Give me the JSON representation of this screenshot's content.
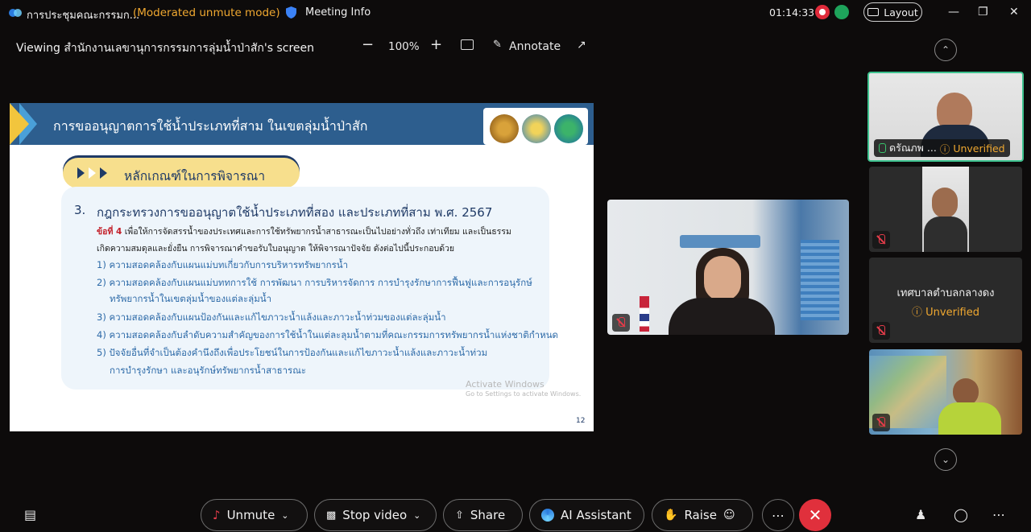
{
  "titlebar": {
    "app_title": "การประชุมคณะกรรมก...",
    "mode": "(Moderated unmute mode)",
    "meeting_info": "Meeting Info",
    "clock": "01:14:33",
    "layout": "Layout"
  },
  "sharebar": {
    "viewing": "Viewing สำนักงานเลขานุการกรรมการลุ่มน้ำป่าสัก's screen",
    "zoom": "100%",
    "annotate": "Annotate"
  },
  "slide": {
    "title": "การขออนุญาตการใช้น้ำประเภทที่สาม ในเขตลุ่มน้ำป่าสัก",
    "heading": "หลักเกณฑ์ในการพิจารณา",
    "item_number": "3.",
    "item_title": "กฎกระทรวงการขออนุญาตใช้น้ำประเภทที่สอง และประเภทที่สาม พ.ศ. 2567",
    "clause_label": "ข้อที่ 4",
    "clause_text": "เพื่อให้การจัดสรรน้ำของประเทศและการใช้ทรัพยากรน้ำสาธารณะเป็นไปอย่างทั่วถึง เท่าเทียม และเป็นธรรม",
    "clause_text2": "เกิดความสมดุลและยั่งยืน การพิจารณาคำขอรับใบอนุญาต ให้พิจารณาปัจจัย ดังต่อไปนี้ประกอบด้วย",
    "points": [
      "1) ความสอดคล้องกับแผนแม่บทเกี่ยวกับการบริหารทรัพยากรน้ำ",
      "2) ความสอดคล้องกับแผนแม่บททการใช้ การพัฒนา การบริหารจัดการ การบำรุงรักษาการฟื้นฟูและการอนุรักษ์",
      "ทรัพยากรน้ำในเขตลุ่มน้ำของแต่ละลุ่มน้ำ",
      "3) ความสอดคล้องกับแผนป้องกันและแก้ไขภาวะน้ำแล้งและภาวะน้ำท่วมของแต่ละลุ่มน้ำ",
      "4) ความสอดคล้องกับลำดับความสำคัญของการใช้น้ำในแต่ละลุมน้ำตามที่คณะกรรมการทรัพยากรน้ำแห่งชาติกำหนด",
      "5)  ปัจจัยอื่นที่จำเป็นต้องคำนึงถึงเพื่อประโยชน์ในการป้องกันและแก้ไขภาวะน้ำแล้งและภาวะน้ำท่วม",
      "การบำรุงรักษา และอนุรักษ์ทรัพยากรน้ำสาธารณะ"
    ],
    "watermark1": "Activate Windows",
    "watermark2": "Go to Settings to activate Windows.",
    "page_number": "12"
  },
  "participants": {
    "p1_name": "ดรัณภพ ...",
    "p1_status": "Unverified",
    "p4_name": "เทศบาลตำบลกลางดง",
    "p4_status": "Unverified"
  },
  "controls": {
    "unmute": "Unmute",
    "stop_video": "Stop video",
    "share": "Share",
    "ai_assistant": "AI Assistant",
    "raise": "Raise"
  },
  "colors": {
    "accent_orange": "#f0a830",
    "end_red": "#e0303c",
    "slide_blue": "#2d5e8e"
  }
}
